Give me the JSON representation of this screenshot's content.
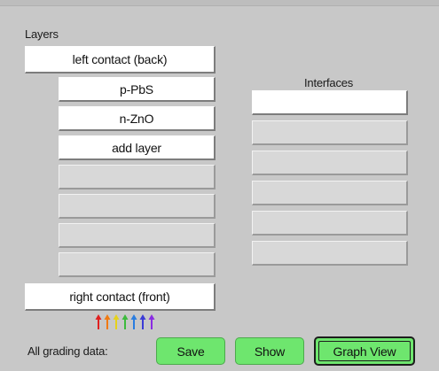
{
  "layers_heading": "Layers",
  "interfaces_heading": "Interfaces",
  "left_contact": "left contact (back)",
  "right_contact": "right contact (front)",
  "layers": [
    "p-PbS",
    "n-ZnO",
    "add layer",
    "",
    "",
    "",
    ""
  ],
  "interfaces": [
    "",
    "",
    "",
    "",
    "",
    ""
  ],
  "footer": {
    "grading_label": "All grading data:",
    "save_label": "Save",
    "show_label": "Show",
    "graph_view_label": "Graph View"
  },
  "colors": {
    "background": "#c8c8c8",
    "button_white": "#ffffff",
    "slot_empty": "#d8d8d8",
    "action_green": "#6ee66e"
  },
  "light_arrows_icon": {
    "name": "spectrum-light-arrows-icon",
    "colors": [
      "#e02020",
      "#f07a10",
      "#e6d21a",
      "#3cba3c",
      "#2a7de0",
      "#3b3bd6",
      "#8a2be2"
    ]
  }
}
